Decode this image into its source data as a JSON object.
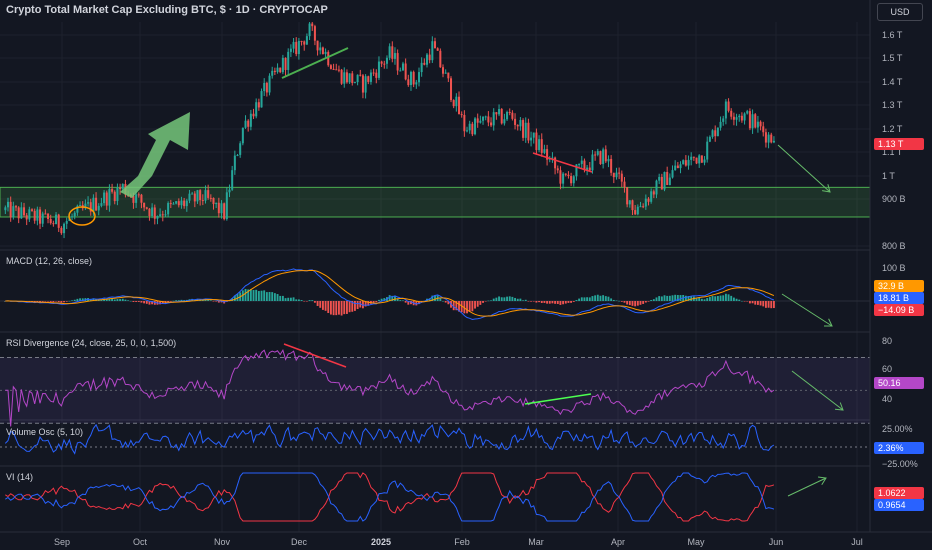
{
  "header": {
    "title": "Crypto Total Market Cap Excluding BTC, $ · 1D · CRYPTOCAP",
    "currency": "USD"
  },
  "panes": {
    "macd": "MACD (12, 26, close)",
    "rsi": "RSI Divergence (24, close, 25, 0, 0, 1,500)",
    "vol": "Volume Osc (5, 10)",
    "vi": "VI (14)"
  },
  "price_axis": [
    "1.6 T",
    "1.5 T",
    "1.4 T",
    "1.3 T",
    "1.2 T",
    "1.1 T",
    "1 T",
    "900 B",
    "800 B"
  ],
  "macd_axis": [
    "100 B"
  ],
  "rsi_axis": [
    "80",
    "60",
    "40"
  ],
  "vol_axis": [
    "25.00%",
    "−25.00%"
  ],
  "tags": {
    "price": "1.13 T",
    "macd1": "32.9 B",
    "macd2": "18.81 B",
    "macd3": "−14.09 B",
    "rsi": "50.16",
    "vol": "2.36%",
    "vi1": "1.0622",
    "vi2": "0.9654"
  },
  "time_axis": [
    "Sep",
    "Oct",
    "Nov",
    "Dec",
    "2025",
    "Feb",
    "Mar",
    "Apr",
    "May",
    "Jun",
    "Jul"
  ],
  "colors": {
    "up": "#26a69a",
    "down": "#ef5350",
    "zone": "#4caf50",
    "macd_line": "#2962ff",
    "signal_line": "#ff9800",
    "rsi_line": "#b447c8",
    "vol_line": "#2962ff",
    "vi_plus": "#2962ff",
    "vi_minus": "#f23645",
    "arrow": "#66bb6a"
  },
  "chart_data": {
    "type": "candlestick",
    "title": "Crypto Total Market Cap Excluding BTC, $ · 1D · CRYPTOCAP",
    "unit": "USD",
    "x_range": [
      "2024-08-13",
      "2025-07-05"
    ],
    "y_range_trillions": [
      0.78,
      1.66
    ],
    "support_zone_trillions": [
      0.88,
      0.97
    ],
    "last_close_trillions": 1.13,
    "close_path": [
      {
        "date": "2024-08-15",
        "close": 0.9
      },
      {
        "date": "2024-09-05",
        "close": 0.86
      },
      {
        "date": "2024-09-28",
        "close": 0.97
      },
      {
        "date": "2024-10-10",
        "close": 0.89
      },
      {
        "date": "2024-10-28",
        "close": 0.94
      },
      {
        "date": "2024-11-05",
        "close": 0.89
      },
      {
        "date": "2024-11-12",
        "close": 1.18
      },
      {
        "date": "2024-11-25",
        "close": 1.42
      },
      {
        "date": "2024-12-07",
        "close": 1.62
      },
      {
        "date": "2024-12-18",
        "close": 1.41
      },
      {
        "date": "2024-12-27",
        "close": 1.36
      },
      {
        "date": "2025-01-06",
        "close": 1.5
      },
      {
        "date": "2025-01-15",
        "close": 1.37
      },
      {
        "date": "2025-01-22",
        "close": 1.54
      },
      {
        "date": "2025-02-03",
        "close": 1.18
      },
      {
        "date": "2025-02-20",
        "close": 1.23
      },
      {
        "date": "2025-03-04",
        "close": 1.1
      },
      {
        "date": "2025-03-12",
        "close": 0.99
      },
      {
        "date": "2025-03-27",
        "close": 1.08
      },
      {
        "date": "2025-04-08",
        "close": 0.9
      },
      {
        "date": "2025-04-23",
        "close": 1.03
      },
      {
        "date": "2025-05-04",
        "close": 1.09
      },
      {
        "date": "2025-05-12",
        "close": 1.26
      },
      {
        "date": "2025-05-20",
        "close": 1.22
      },
      {
        "date": "2025-05-30",
        "close": 1.13
      }
    ],
    "indicators": {
      "macd": {
        "macd": 18.81,
        "signal": 32.9,
        "histogram": -14.09,
        "unit": "B"
      },
      "rsi": 50.16,
      "volume_osc_percent": 2.36,
      "vi": {
        "plus": 1.0622,
        "minus": 0.9654
      }
    }
  }
}
